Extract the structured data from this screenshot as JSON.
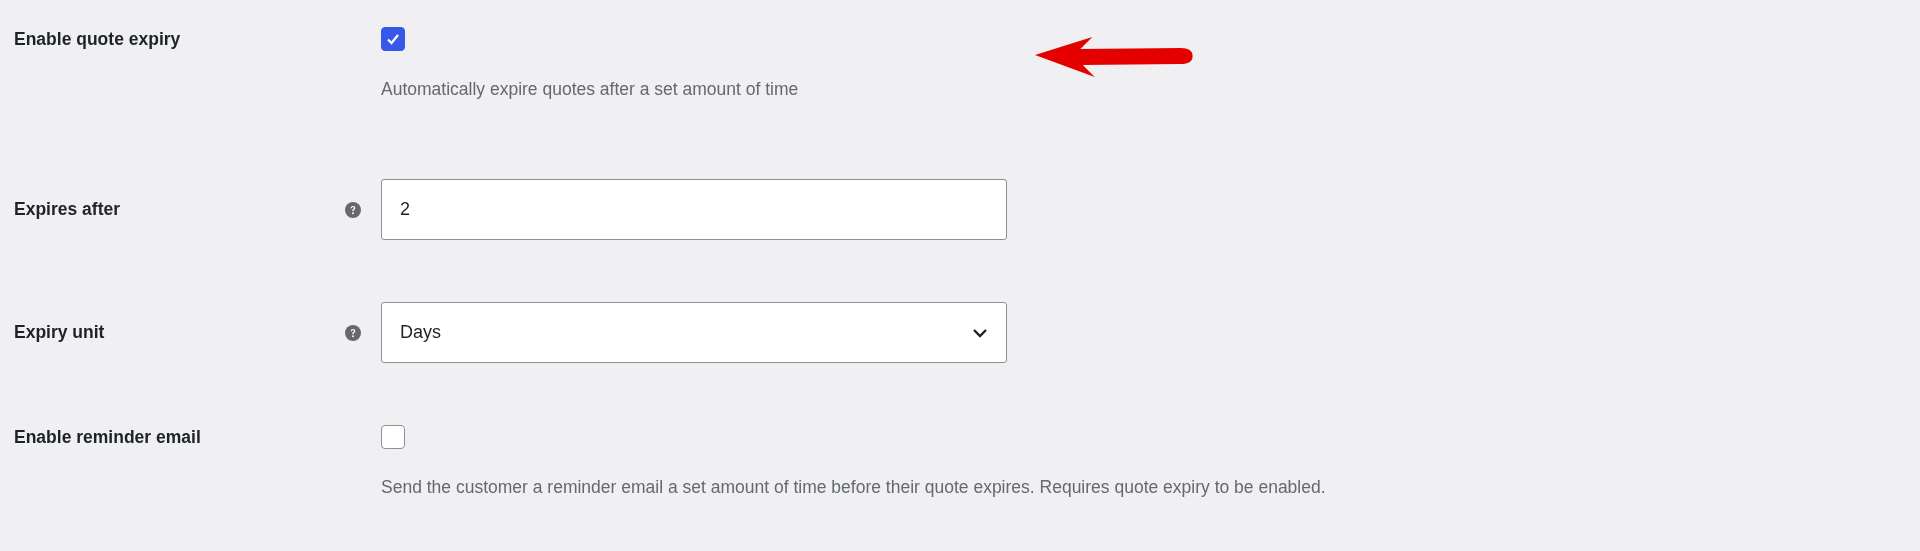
{
  "fields": [
    {
      "kind": "checkbox",
      "label": "Enable quote expiry",
      "checked": true,
      "help_icon": false,
      "description": "Automatically expire quotes after a set amount of time"
    },
    {
      "kind": "input",
      "label": "Expires after",
      "help_icon": true,
      "value": "2"
    },
    {
      "kind": "select",
      "label": "Expiry unit",
      "help_icon": true,
      "value": "Days"
    },
    {
      "kind": "checkbox",
      "label": "Enable reminder email",
      "checked": false,
      "help_icon": false,
      "description": "Send the customer a reminder email a set amount of time before their quote expires. Requires quote expiry to be enabled."
    }
  ]
}
